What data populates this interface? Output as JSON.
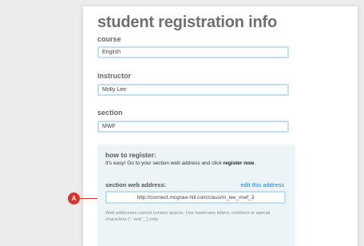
{
  "form": {
    "title": "student registration info",
    "course_label": "course",
    "course_value": "English",
    "instructor_label": "instructor",
    "instructor_value": "Molly Lee",
    "section_label": "section",
    "section_value": "MWF"
  },
  "register": {
    "heading": "how to register:",
    "instructions_prefix": "It's easy! Go to your section web address and click ",
    "instructions_bold": "register now",
    "instructions_suffix": ".",
    "web_address_label": "section web address:",
    "edit_link": "edit this address",
    "web_address_value": "http://connect.mcgraw-hill.com/class/m_lee_mwf_3",
    "helper_text": "Web addresses cannot contain spaces. Use lowercase letters, numbers or special characters ('-' and '_') only."
  },
  "annotation": {
    "marker_label": "A",
    "marker_color": "#d9342b"
  },
  "colors": {
    "field_border": "#bfe0f0",
    "register_background": "#edf4f8",
    "link": "#2e82c6"
  }
}
